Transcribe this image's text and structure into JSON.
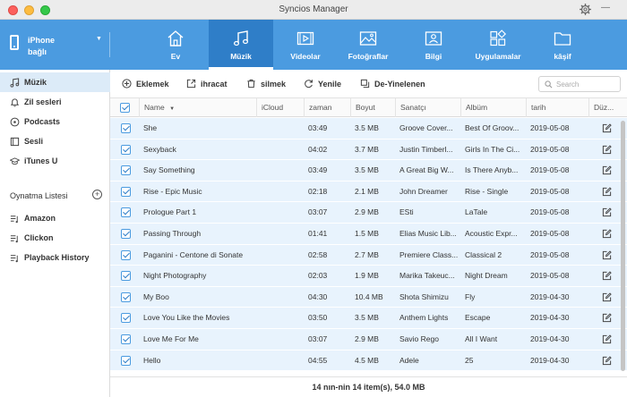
{
  "window": {
    "title": "Syncios Manager"
  },
  "device": {
    "name": "iPhone",
    "state": "bağlı"
  },
  "nav_tabs": [
    {
      "label": "Ev",
      "icon": "home-icon"
    },
    {
      "label": "Müzik",
      "icon": "music-note-icon",
      "active": true
    },
    {
      "label": "Videolar",
      "icon": "video-icon"
    },
    {
      "label": "Fotoğraflar",
      "icon": "photo-icon"
    },
    {
      "label": "Bilgi",
      "icon": "contact-card-icon"
    },
    {
      "label": "Uygulamalar",
      "icon": "apps-icon"
    },
    {
      "label": "kâşif",
      "icon": "folder-icon"
    }
  ],
  "sidebar": {
    "items": [
      {
        "label": "Müzik",
        "icon": "music-icon",
        "active": true
      },
      {
        "label": "Zil sesleri",
        "icon": "bell-icon"
      },
      {
        "label": "Podcasts",
        "icon": "podcast-icon"
      },
      {
        "label": "Sesli",
        "icon": "audiobook-icon"
      },
      {
        "label": "iTunes U",
        "icon": "graduation-cap-icon"
      }
    ],
    "playlist_header": "Oynatma Listesi",
    "playlists": [
      {
        "label": "Amazon",
        "icon": "playlist-icon"
      },
      {
        "label": "Clickon",
        "icon": "playlist-icon"
      },
      {
        "label": "Playback History",
        "icon": "playlist-icon"
      }
    ]
  },
  "toolbar": {
    "add_label": "Eklemek",
    "export_label": "ihracat",
    "delete_label": "silmek",
    "refresh_label": "Yenile",
    "dedupe_label": "De-Yinelenen",
    "search_placeholder": "Search"
  },
  "table": {
    "headers": {
      "name": "Name",
      "icloud": "iCloud",
      "time": "zaman",
      "size": "Boyut",
      "artist": "Sanatçı",
      "album": "Albüm",
      "date": "tarih",
      "edit": "Düz..."
    },
    "rows": [
      {
        "name": "She",
        "time": "03:49",
        "size": "3.5 MB",
        "artist": "Groove Cover...",
        "album": "Best Of Groov...",
        "date": "2019-05-08"
      },
      {
        "name": "Sexyback",
        "time": "04:02",
        "size": "3.7 MB",
        "artist": "Justin Timberl...",
        "album": "Girls In The Ci...",
        "date": "2019-05-08"
      },
      {
        "name": "Say Something",
        "time": "03:49",
        "size": "3.5 MB",
        "artist": "A Great Big W...",
        "album": "Is There Anyb...",
        "date": "2019-05-08"
      },
      {
        "name": "Rise - Epic Music",
        "time": "02:18",
        "size": "2.1 MB",
        "artist": "John Dreamer",
        "album": "Rise - Single",
        "date": "2019-05-08"
      },
      {
        "name": "Prologue Part 1",
        "time": "03:07",
        "size": "2.9 MB",
        "artist": "ESti",
        "album": "LaTale",
        "date": "2019-05-08"
      },
      {
        "name": "Passing Through",
        "time": "01:41",
        "size": "1.5 MB",
        "artist": "Elias Music Lib...",
        "album": "Acoustic Expr...",
        "date": "2019-05-08"
      },
      {
        "name": "Paganini - Centone di Sonate",
        "time": "02:58",
        "size": "2.7 MB",
        "artist": "Premiere Class...",
        "album": "Classical 2",
        "date": "2019-05-08"
      },
      {
        "name": "Night Photography",
        "time": "02:03",
        "size": "1.9 MB",
        "artist": "Marika Takeuc...",
        "album": "Night Dream",
        "date": "2019-05-08"
      },
      {
        "name": "My Boo",
        "time": "04:30",
        "size": "10.4 MB",
        "artist": "Shota Shimizu",
        "album": "Fly",
        "date": "2019-04-30"
      },
      {
        "name": "Love You Like the Movies",
        "time": "03:50",
        "size": "3.5 MB",
        "artist": "Anthem Lights",
        "album": "Escape",
        "date": "2019-04-30"
      },
      {
        "name": "Love Me For Me",
        "time": "03:07",
        "size": "2.9 MB",
        "artist": "Savio Rego",
        "album": "All I Want",
        "date": "2019-04-30"
      },
      {
        "name": "Hello",
        "time": "04:55",
        "size": "4.5 MB",
        "artist": "Adele",
        "album": "25",
        "date": "2019-04-30"
      }
    ]
  },
  "status": {
    "text": "14 nın-nin 14 item(s), 54.0 MB"
  },
  "colors": {
    "nav_blue": "#4b9be0",
    "nav_active": "#2f7ec8",
    "row_selected": "#e8f3fd",
    "sidebar_active": "#dcebf8"
  }
}
